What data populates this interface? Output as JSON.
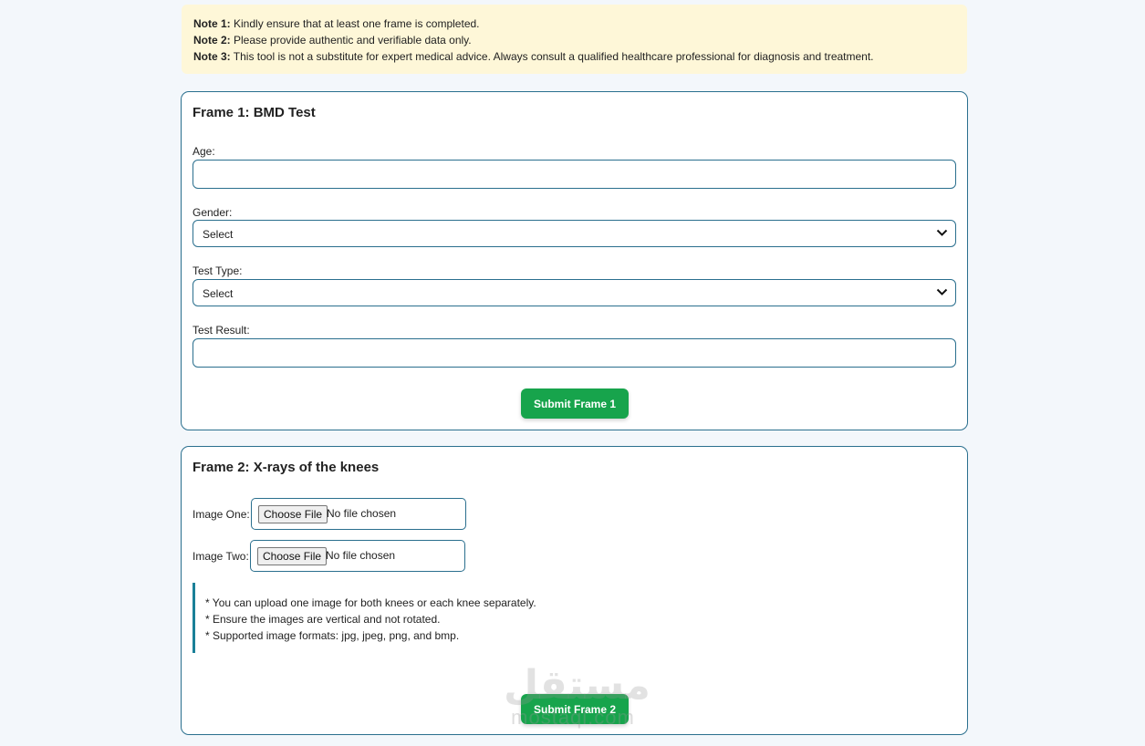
{
  "notes": [
    {
      "label": "Note 1:",
      "text": "Kindly ensure that at least one frame is completed."
    },
    {
      "label": "Note 2:",
      "text": "Please provide authentic and verifiable data only."
    },
    {
      "label": "Note 3:",
      "text": "This tool is not a substitute for expert medical advice. Always consult a qualified healthcare professional for diagnosis and treatment."
    }
  ],
  "frame1": {
    "title": "Frame 1: BMD Test",
    "age_label": "Age:",
    "age_value": "",
    "gender_label": "Gender:",
    "gender_selected": "Select",
    "test_type_label": "Test Type:",
    "test_type_selected": "Select",
    "test_result_label": "Test Result:",
    "test_result_value": "",
    "submit_label": "Submit Frame 1"
  },
  "frame2": {
    "title": "Frame 2: X-rays of the knees",
    "image_one_label": "Image One:",
    "image_two_label": "Image Two:",
    "choose_file_label": "Choose File",
    "no_file_text": "No file chosen",
    "info": [
      "* You can upload one image for both knees or each knee separately.",
      "* Ensure the images are vertical and not rotated.",
      "* Supported image formats: jpg, jpeg, png, and bmp."
    ],
    "submit_label": "Submit Frame 2"
  },
  "watermark": {
    "arabic": "مستقل",
    "latin": "mostaql.com"
  },
  "colors": {
    "accent_border": "#2a6f8e",
    "submit_green": "#17a44c",
    "note_bg": "#fef7d8",
    "info_bar": "#1a8098"
  },
  "icons": {
    "select_arrow": "chevron-down-icon"
  }
}
